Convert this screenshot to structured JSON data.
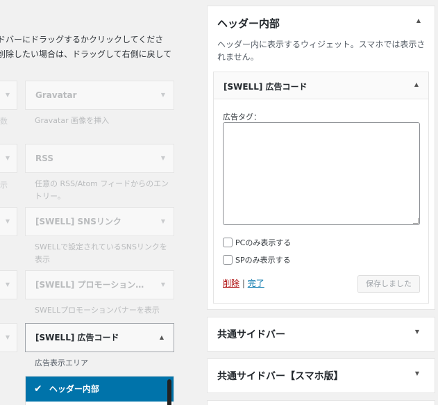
{
  "available": {
    "intro_line1": "ドバーにドラッグするかクリックしてくださ",
    "intro_line2": "削除したい場合は、ドラッグして右側に戻して",
    "widgets": [
      {
        "title": "Gravatar",
        "desc": "Gravatar 画像を挿入",
        "stub_desc": "数"
      },
      {
        "title": "RSS",
        "desc": "任意の RSS/Atom フィードからのエントリー。",
        "stub_desc": "示"
      },
      {
        "title": "[SWELL] SNSリンク",
        "desc": "SWELLで設定されているSNSリンクを表示",
        "stub_desc": ""
      },
      {
        "title": "[SWELL] プロモーション…",
        "desc": "SWELLプロモーションバナーを表示",
        "stub_desc": ""
      }
    ],
    "active_widget": "[SWELL] 広告コード",
    "area_label": "広告表示エリア",
    "area_selected": "ヘッダー内部"
  },
  "header_sidebar": {
    "title": "ヘッダー内部",
    "description": "ヘッダー内に表示するウィジェット。スマホでは表示されません。",
    "widget": {
      "title": "[SWELL] 広告コード",
      "field_label": "広告タグ：",
      "field_value": "",
      "pc_only": "PCのみ表示する",
      "sp_only": "SPのみ表示する",
      "delete": "削除",
      "separator": "|",
      "done": "完了",
      "saved": "保存しました"
    }
  },
  "collapsed_sidebars": [
    {
      "title": "共通サイドバー"
    },
    {
      "title": "共通サイドバー【スマホ版】"
    }
  ],
  "colors": {
    "accent": "#0073aa",
    "delete": "#aa0000"
  }
}
